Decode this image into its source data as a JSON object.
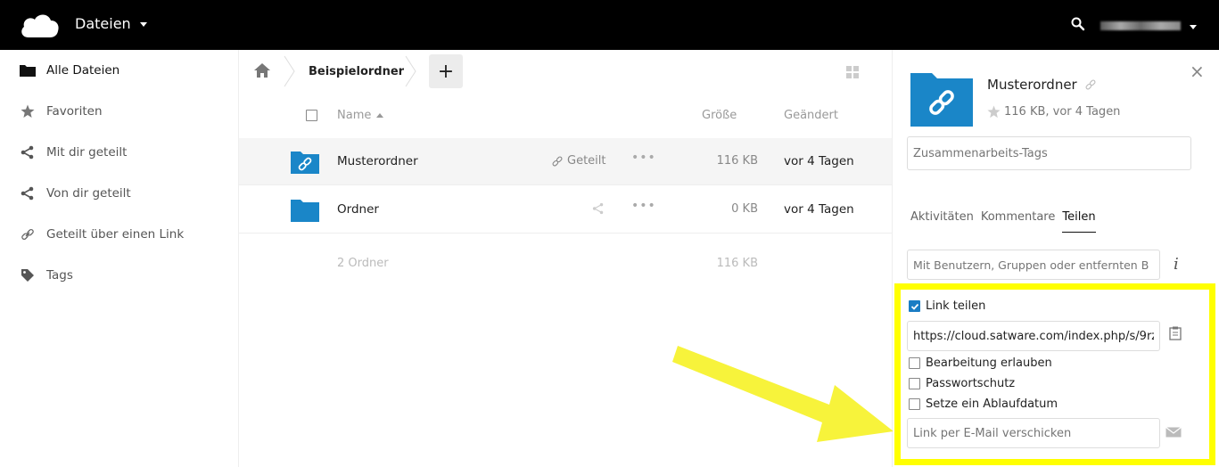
{
  "header": {
    "app_title": "Dateien",
    "highlight_color": "#ffff00",
    "bar_color": "#000000"
  },
  "sidebar": {
    "items": [
      {
        "label": "Alle Dateien",
        "icon": "folder-icon"
      },
      {
        "label": "Favoriten",
        "icon": "star-icon"
      },
      {
        "label": "Mit dir geteilt",
        "icon": "share-icon"
      },
      {
        "label": "Von dir geteilt",
        "icon": "share-icon"
      },
      {
        "label": "Geteilt über einen Link",
        "icon": "link-icon"
      },
      {
        "label": "Tags",
        "icon": "tag-icon"
      }
    ]
  },
  "breadcrumb": {
    "current": "Beispielordner",
    "add_label": "+"
  },
  "table": {
    "columns": {
      "name": "Name",
      "size": "Größe",
      "modified": "Geändert"
    },
    "rows": [
      {
        "name": "Musterordner",
        "share_label": "Geteilt",
        "more": "•••",
        "size": "116 KB",
        "modified": "vor 4 Tagen"
      },
      {
        "name": "Ordner",
        "share_label": "",
        "more": "•••",
        "size": "0 KB",
        "modified": "vor 4 Tagen"
      }
    ],
    "summary": {
      "count": "2 Ordner",
      "size": "116 KB"
    }
  },
  "panel": {
    "close": "×",
    "title": "Musterordner",
    "meta": "116 KB, vor 4 Tagen",
    "tags_placeholder": "Zusammenarbeits-Tags",
    "tabs": [
      "Aktivitäten",
      "Kommentare",
      "Teilen"
    ],
    "active_tab": "Teilen",
    "share_placeholder": "Mit Benutzern, Gruppen oder entfernten B",
    "info": "i",
    "link_share_label": "Link teilen",
    "link_url": "https://cloud.satware.com/index.php/s/9rz",
    "options": [
      "Bearbeitung erlauben",
      "Passwortschutz",
      "Setze ein Ablaufdatum"
    ],
    "mail_placeholder": "Link per E-Mail verschicken"
  }
}
